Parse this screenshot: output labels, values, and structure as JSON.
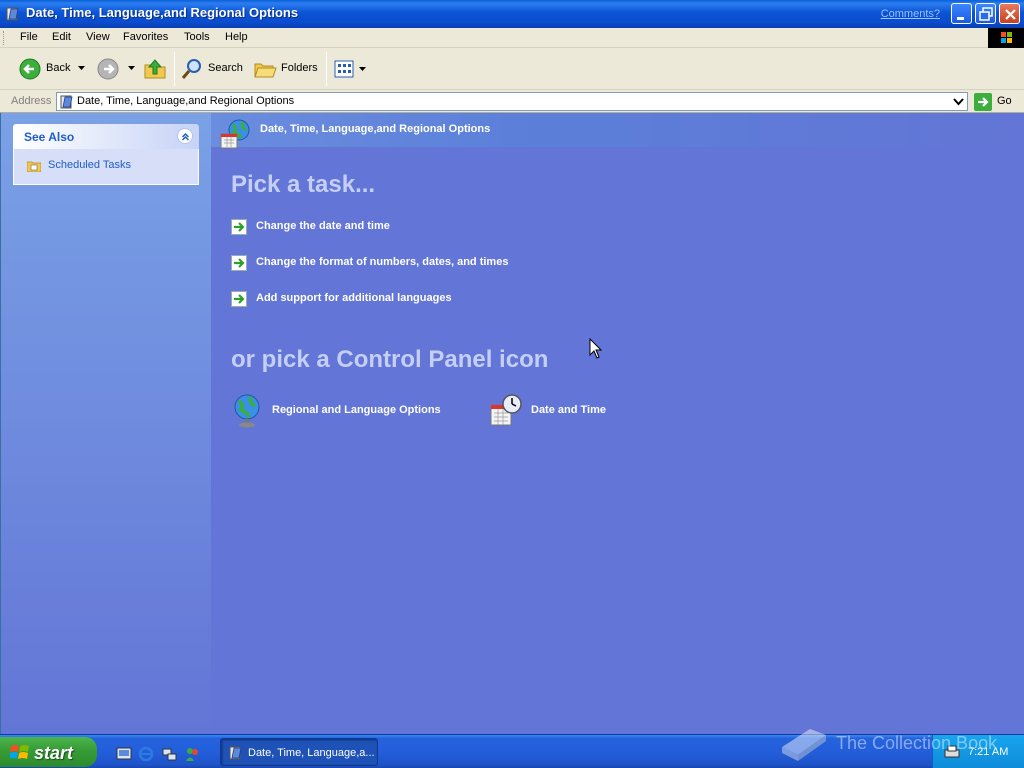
{
  "window": {
    "title": "Date, Time, Language,and Regional Options",
    "comments_link": "Comments?"
  },
  "menu": [
    "File",
    "Edit",
    "View",
    "Favorites",
    "Tools",
    "Help"
  ],
  "toolbar": {
    "back": "Back",
    "search": "Search",
    "folders": "Folders"
  },
  "address": {
    "label": "Address",
    "value": "Date, Time, Language,and Regional Options",
    "go": "Go"
  },
  "see_also": {
    "title": "See Also",
    "items": [
      "Scheduled Tasks"
    ]
  },
  "main": {
    "header": "Date, Time, Language,and Regional Options",
    "pick_task": "Pick a task...",
    "tasks": [
      "Change the date and time",
      "Change the format of numbers, dates, and times",
      "Add support for additional languages"
    ],
    "pick_icon": "or pick a Control Panel icon",
    "icons": [
      "Regional and Language Options",
      "Date and Time"
    ]
  },
  "taskbar": {
    "start": "start",
    "task_button": "Date, Time, Language,a...",
    "clock": "7:21 AM",
    "watermark": "The Collection Book"
  },
  "colors": {
    "titlebar": "#0a54d6",
    "pane_blue": "#6375d6",
    "link_blue": "#215dc6",
    "start_green": "#389e38"
  }
}
